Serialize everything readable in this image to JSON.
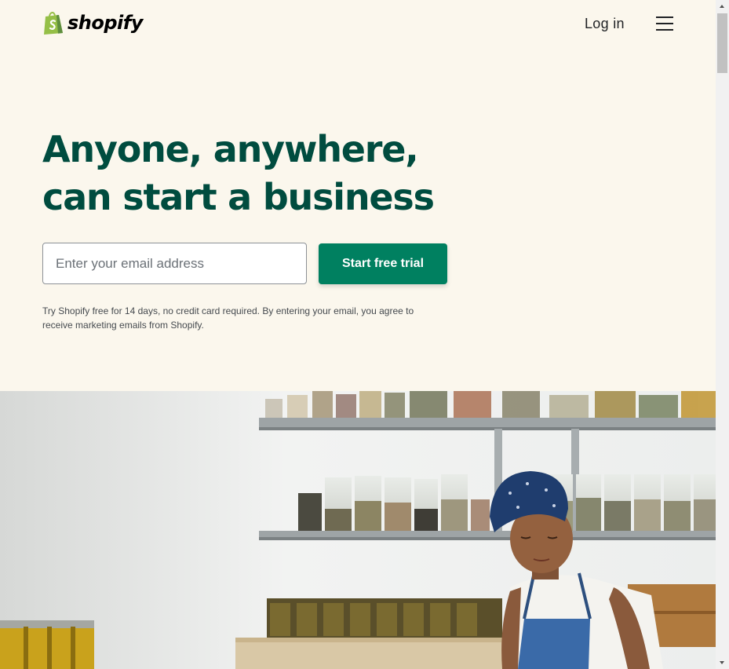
{
  "header": {
    "logo_text": "shopify",
    "login_label": "Log in",
    "menu_icon": "hamburger-menu-icon"
  },
  "hero": {
    "headline": "Anyone, anywhere, can start a business",
    "email_placeholder": "Enter your email address",
    "cta_label": "Start free trial",
    "disclaimer": "Try Shopify free for 14 days, no credit card required. By entering your email, you agree to receive marketing emails from Shopify."
  },
  "colors": {
    "background": "#fbf7ed",
    "headline": "#004c3f",
    "cta": "#008060",
    "logo_bag": "#95bf47"
  }
}
